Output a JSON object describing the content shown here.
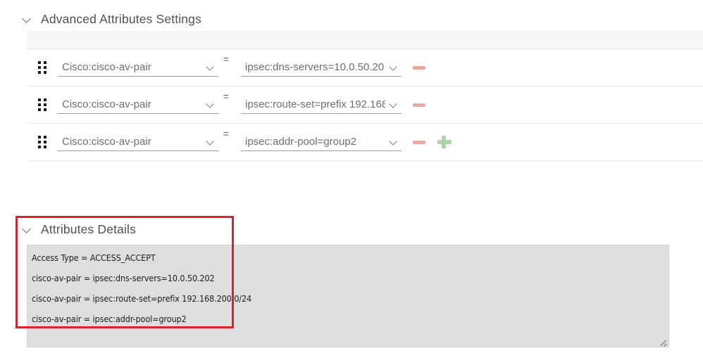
{
  "advanced_section": {
    "title": "Advanced Attributes Settings",
    "chevron_icon": "chevron-down-icon",
    "equals_symbol": "=",
    "rows": [
      {
        "drag_handle_icon": "drag-handle-icon",
        "attribute_name": "Cisco:cisco-av-pair",
        "attribute_value": "ipsec:dns-servers=10.0.50.20",
        "has_minus": true,
        "has_plus": false
      },
      {
        "drag_handle_icon": "drag-handle-icon",
        "attribute_name": "Cisco:cisco-av-pair",
        "attribute_value": "ipsec:route-set=prefix 192.168",
        "has_minus": true,
        "has_plus": false
      },
      {
        "drag_handle_icon": "drag-handle-icon",
        "attribute_name": "Cisco:cisco-av-pair",
        "attribute_value": "ipsec:addr-pool=group2",
        "has_minus": true,
        "has_plus": true
      }
    ]
  },
  "details_section": {
    "title": "Attributes Details",
    "chevron_icon": "chevron-down-icon",
    "lines": [
      "Access Type = ACCESS_ACCEPT",
      "cisco-av-pair = ipsec:dns-servers=10.0.50.202",
      "cisco-av-pair = ipsec:route-set=prefix 192.168.200.0/24",
      "cisco-av-pair = ipsec:addr-pool=group2"
    ],
    "resize_grip_icon": "resize-grip-icon"
  },
  "colors": {
    "annotation_red": "#d9232e",
    "minus_button": "#e8a9a0",
    "plus_button": "#b4cfae",
    "details_background": "#dedede",
    "header_strip": "#f6f6f7",
    "title_text": "#4e5053",
    "dropdown_text": "#6d6e71"
  }
}
